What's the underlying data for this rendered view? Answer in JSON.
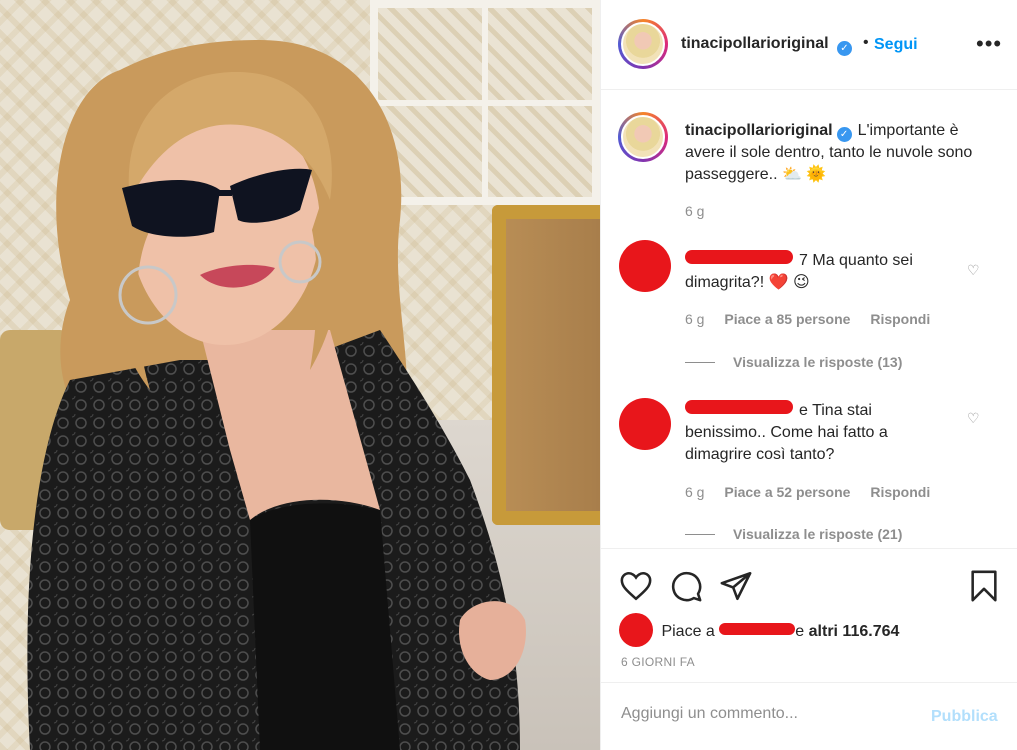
{
  "post": {
    "image_alt": "Woman with wavy blonde hair and dark sunglasses wearing a black lace jacket"
  },
  "header": {
    "username": "tinacipollarioriginal",
    "dot": "•",
    "follow_label": "Segui",
    "more_icon": "more-horizontal-icon"
  },
  "caption": {
    "username": "tinacipollarioriginal",
    "text": "L'importante è avere il sole dentro, tanto le nuvole sono passeggere..",
    "emoji": "⛅ 🌞",
    "time": "6 g"
  },
  "comments": [
    {
      "user_suffix": "7",
      "text": "Ma quanto sei dimagrita?!",
      "emoji": "❤️ 😉",
      "time": "6 g",
      "likes_label": "Piace a 85 persone",
      "reply_label": "Rispondi",
      "view_replies": "Visualizza le risposte (13)"
    },
    {
      "user_suffix": "e",
      "text": "Tina stai benissimo.. Come hai fatto a dimagrire così tanto?",
      "time": "6 g",
      "likes_label": "Piace a 52 persone",
      "reply_label": "Rispondi",
      "view_replies": "Visualizza le risposte (21)"
    }
  ],
  "actions": {
    "icons": [
      "heart-icon",
      "comment-icon",
      "share-icon",
      "bookmark-icon"
    ],
    "likes_prefix": "Piace a",
    "likes_suffix_char": "e",
    "likes_others": "altri 116.764",
    "posted_ago": "6 GIORNI FA"
  },
  "add_comment": {
    "placeholder": "Aggiungi un commento...",
    "publish_label": "Pubblica"
  },
  "colors": {
    "link_blue": "#0095f6",
    "verified_blue": "#3897f0",
    "muted_gray": "#8e8e8e",
    "text": "#262626",
    "redaction_red": "#e8161b",
    "publish_disabled": "#b2dffc"
  }
}
